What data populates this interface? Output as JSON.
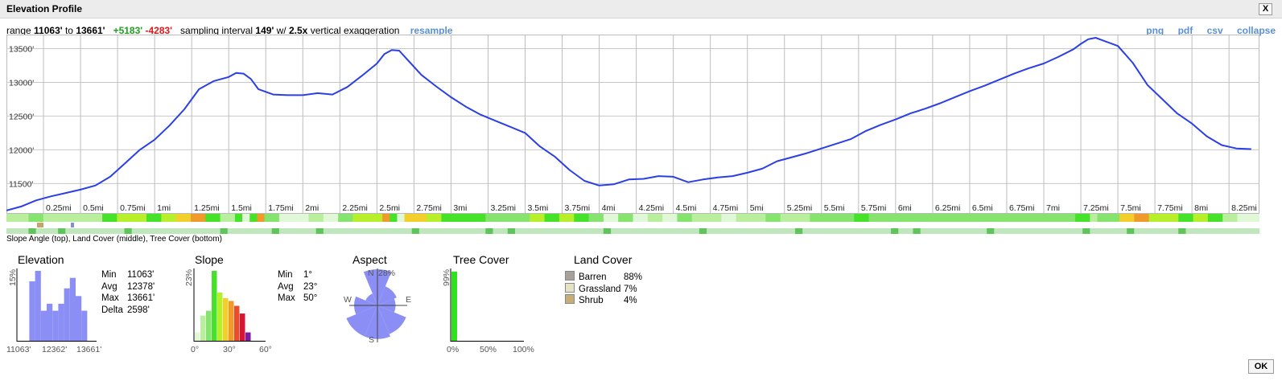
{
  "window": {
    "title": "Elevation Profile",
    "close_label": "X",
    "ok_label": "OK"
  },
  "summary": {
    "range_label": "range",
    "min": "11063'",
    "to_label": "to",
    "max": "13661'",
    "gain": "+5183'",
    "loss": "-4283'",
    "interval_label": "sampling interval",
    "interval": "149'",
    "w_label": "w/",
    "exaggeration": "2.5x",
    "exaggeration_label": "vertical exaggeration",
    "resample_label": "resample"
  },
  "links": {
    "png": "png",
    "pdf": "pdf",
    "csv": "csv",
    "collapse": "collapse"
  },
  "strip_legend": "Slope Angle (top), Land Cover (middle), Tree Cover (bottom)",
  "colors": {
    "profile_line": "#2a3fe6",
    "histogram": "#8b8ff5",
    "grid": "#c8c8c8"
  },
  "chart_data": [
    {
      "type": "line",
      "name": "elevation-profile",
      "xlabel": "",
      "ylabel": "",
      "xlim": [
        0,
        8.45
      ],
      "ylim": [
        11063,
        13661
      ],
      "y_ticks": [
        11500,
        12000,
        12500,
        13000,
        13500
      ],
      "y_tick_labels": [
        "11500'",
        "12000'",
        "12500'",
        "13000'",
        "13500'"
      ],
      "x_ticks": [
        0.25,
        0.5,
        0.75,
        1,
        1.25,
        1.5,
        1.75,
        2,
        2.25,
        2.5,
        2.75,
        3,
        3.25,
        3.5,
        3.75,
        4,
        4.25,
        4.5,
        4.75,
        5,
        5.25,
        5.5,
        5.75,
        6,
        6.25,
        6.5,
        6.75,
        7,
        7.25,
        7.5,
        7.75,
        8,
        8.25
      ],
      "x_tick_labels": [
        "0.25mi",
        "0.5mi",
        "0.75mi",
        "1mi",
        "1.25mi",
        "1.5mi",
        "1.75mi",
        "2mi",
        "2.25mi",
        "2.5mi",
        "2.75mi",
        "3mi",
        "3.25mi",
        "3.5mi",
        "3.75mi",
        "4mi",
        "4.25mi",
        "4.5mi",
        "4.75mi",
        "5mi",
        "5.25mi",
        "5.5mi",
        "5.75mi",
        "6mi",
        "6.25mi",
        "6.5mi",
        "6.75mi",
        "7mi",
        "7.25mi",
        "7.5mi",
        "7.75mi",
        "8mi",
        "8.25mi"
      ],
      "grid": true,
      "x": [
        0,
        0.1,
        0.2,
        0.3,
        0.4,
        0.5,
        0.6,
        0.7,
        0.8,
        0.9,
        1.0,
        1.1,
        1.2,
        1.3,
        1.4,
        1.5,
        1.55,
        1.6,
        1.65,
        1.7,
        1.8,
        1.9,
        2.0,
        2.1,
        2.2,
        2.3,
        2.4,
        2.5,
        2.55,
        2.6,
        2.65,
        2.7,
        2.8,
        2.9,
        3.0,
        3.1,
        3.2,
        3.3,
        3.4,
        3.5,
        3.6,
        3.7,
        3.8,
        3.9,
        4.0,
        4.1,
        4.2,
        4.3,
        4.4,
        4.5,
        4.6,
        4.7,
        4.8,
        4.9,
        5.0,
        5.1,
        5.2,
        5.3,
        5.4,
        5.5,
        5.6,
        5.7,
        5.8,
        5.9,
        6.0,
        6.1,
        6.2,
        6.3,
        6.4,
        6.5,
        6.6,
        6.7,
        6.8,
        6.9,
        7.0,
        7.1,
        7.2,
        7.25,
        7.3,
        7.35,
        7.4,
        7.5,
        7.6,
        7.7,
        7.8,
        7.9,
        8.0,
        8.1,
        8.2,
        8.3,
        8.4
      ],
      "y": [
        11100,
        11160,
        11250,
        11310,
        11360,
        11410,
        11470,
        11600,
        11800,
        12000,
        12150,
        12360,
        12600,
        12900,
        13020,
        13080,
        13140,
        13130,
        13050,
        12900,
        12820,
        12810,
        12810,
        12840,
        12820,
        12930,
        13100,
        13280,
        13420,
        13480,
        13470,
        13350,
        13110,
        12940,
        12780,
        12640,
        12520,
        12430,
        12340,
        12250,
        12050,
        11900,
        11700,
        11540,
        11470,
        11490,
        11560,
        11570,
        11610,
        11600,
        11520,
        11560,
        11590,
        11610,
        11660,
        11720,
        11830,
        11890,
        11950,
        12020,
        12090,
        12160,
        12280,
        12370,
        12450,
        12540,
        12610,
        12690,
        12780,
        12870,
        12950,
        13040,
        13130,
        13210,
        13280,
        13380,
        13490,
        13570,
        13640,
        13661,
        13620,
        13540,
        13290,
        12960,
        12750,
        12540,
        12390,
        12200,
        12070,
        12020,
        12010
      ]
    },
    {
      "type": "bar",
      "name": "elevation-histogram",
      "values": [
        0.0,
        0.0,
        0.85,
        1.0,
        0.43,
        0.53,
        0.43,
        0.53,
        0.75,
        0.9,
        0.64,
        0.43,
        0.0
      ],
      "y_label": "15%",
      "x_tick_labels": [
        "11063'",
        "12362'",
        "13661'"
      ]
    },
    {
      "type": "bar",
      "name": "slope-histogram",
      "values": [
        0.12,
        0.36,
        0.43,
        1.0,
        0.69,
        0.61,
        0.57,
        0.5,
        0.39,
        0.12
      ],
      "colors": [
        "#e0f7d8",
        "#b9ef9c",
        "#84e46e",
        "#46e22a",
        "#b7f02b",
        "#f3cf2c",
        "#f09a2b",
        "#ee4a2b",
        "#d41536",
        "#7b1aa2"
      ],
      "y_label": "23%",
      "x_tick_labels": [
        "0°",
        "30°",
        "60°"
      ]
    },
    {
      "type": "bar",
      "name": "aspect-rose",
      "directions": [
        "N",
        "NE",
        "E",
        "SE",
        "S",
        "SW",
        "W",
        "NW"
      ],
      "values": [
        0.28,
        0.16,
        0.14,
        0.24,
        0.26,
        0.26,
        0.18,
        0.1
      ],
      "max_label": "28%",
      "labels": {
        "N": "N",
        "E": "E",
        "S": "S",
        "W": "W"
      }
    },
    {
      "type": "bar",
      "name": "tree-cover-histogram",
      "values": [
        0.99
      ],
      "y_label": "99%",
      "x_tick_labels": [
        "0%",
        "50%",
        "100%"
      ]
    }
  ],
  "elevation_stats": {
    "title": "Elevation",
    "labels": [
      "Min",
      "Avg",
      "Max",
      "Delta"
    ],
    "values": [
      "11063'",
      "12378'",
      "13661'",
      "2598'"
    ]
  },
  "slope_stats": {
    "title": "Slope",
    "labels": [
      "Min",
      "Avg",
      "Max"
    ],
    "values": [
      "1°",
      "23°",
      "50°"
    ]
  },
  "aspect": {
    "title": "Aspect"
  },
  "tree_cover": {
    "title": "Tree Cover"
  },
  "land_cover": {
    "title": "Land Cover",
    "items": [
      {
        "name": "Barren",
        "pct": "88%",
        "color": "#a6a29a"
      },
      {
        "name": "Grassland",
        "pct": "7%",
        "color": "#e6e3c4"
      },
      {
        "name": "Shrub",
        "pct": "4%",
        "color": "#c9ad78"
      }
    ]
  }
}
